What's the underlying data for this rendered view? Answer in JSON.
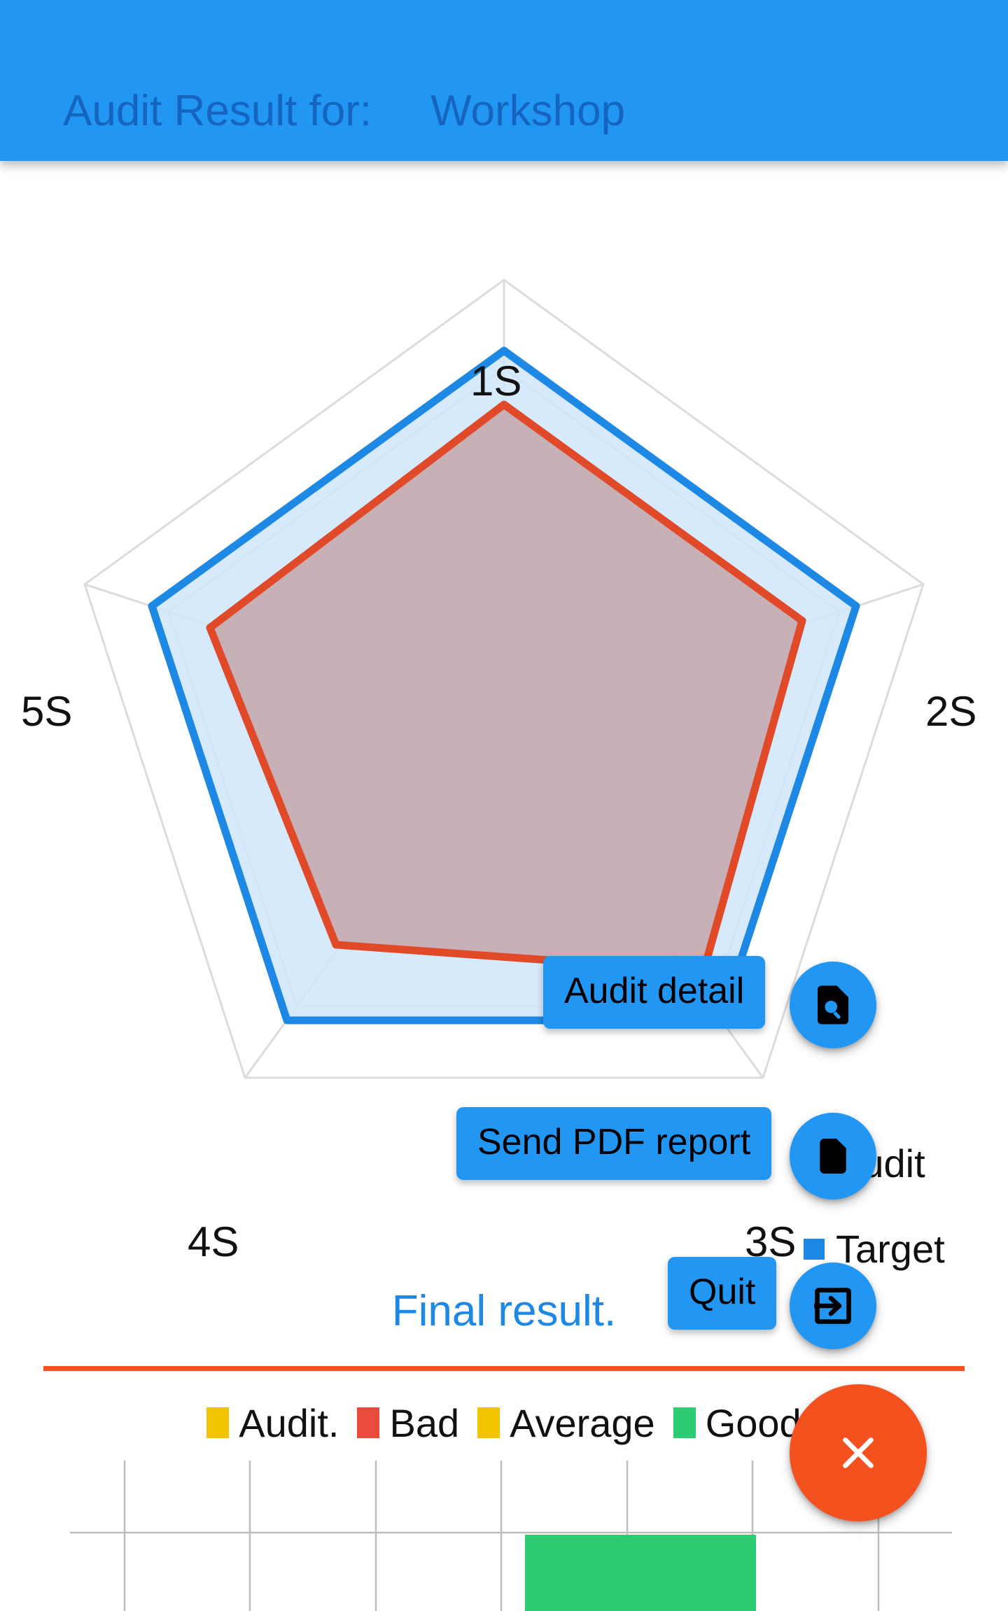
{
  "appbar": {
    "title": "Audit Result for:",
    "subject": "Workshop",
    "bg_color": "#2196F3",
    "text_color": "#1565C0"
  },
  "radar": {
    "labels": [
      "1S",
      "2S",
      "3S",
      "4S",
      "5S"
    ],
    "legend": [
      {
        "name": "Audit",
        "color": "#E04A28"
      },
      {
        "name": "Target",
        "color": "#1E88E5"
      }
    ]
  },
  "final_result": {
    "heading": "Final result.",
    "rule_color": "#F4511E",
    "heading_color": "#1E88E5"
  },
  "bar_legend": [
    {
      "label": "Audit.",
      "color": "#F2C300"
    },
    {
      "label": "Bad",
      "color": "#E94B3C"
    },
    {
      "label": "Average",
      "color": "#F2C300"
    },
    {
      "label": "Good",
      "color": "#2ECC71"
    }
  ],
  "fab_actions": [
    {
      "label": "Audit detail",
      "icon": "document-search-icon"
    },
    {
      "label": "Send PDF report",
      "icon": "document-icon"
    },
    {
      "label": "Quit",
      "icon": "exit-icon"
    }
  ],
  "fab_main": {
    "icon": "close-icon",
    "color": "#F4511E"
  },
  "chart_data": {
    "type": "line",
    "subtype": "radar",
    "title": "Audit Result for: Workshop",
    "categories": [
      "1S",
      "2S",
      "3S",
      "4S",
      "5S"
    ],
    "rings": 5,
    "rmax": 5,
    "series": [
      {
        "name": "Target",
        "color": "#1E88E5",
        "fill": "#CFE6FA",
        "values": [
          4.2,
          4.2,
          4.2,
          4.2,
          4.2
        ]
      },
      {
        "name": "Audit",
        "color": "#E04A28",
        "fill": "#C9A0A0",
        "values": [
          3.6,
          3.6,
          3.3,
          3.3,
          3.6
        ]
      }
    ],
    "grid": true,
    "legend_position": "right"
  },
  "chart_data_bottom": {
    "type": "bar",
    "categories": [
      "Bad",
      "Average",
      "Good"
    ],
    "series": [
      {
        "name": "Result",
        "values": [
          0,
          0,
          1
        ],
        "color": "#2ECC71"
      }
    ],
    "legend": [
      "Audit.",
      "Bad",
      "Average",
      "Good"
    ],
    "grid": true,
    "note": "Bottom bar chart is cropped by the viewport; only a single green 'Good' bar is visible."
  }
}
